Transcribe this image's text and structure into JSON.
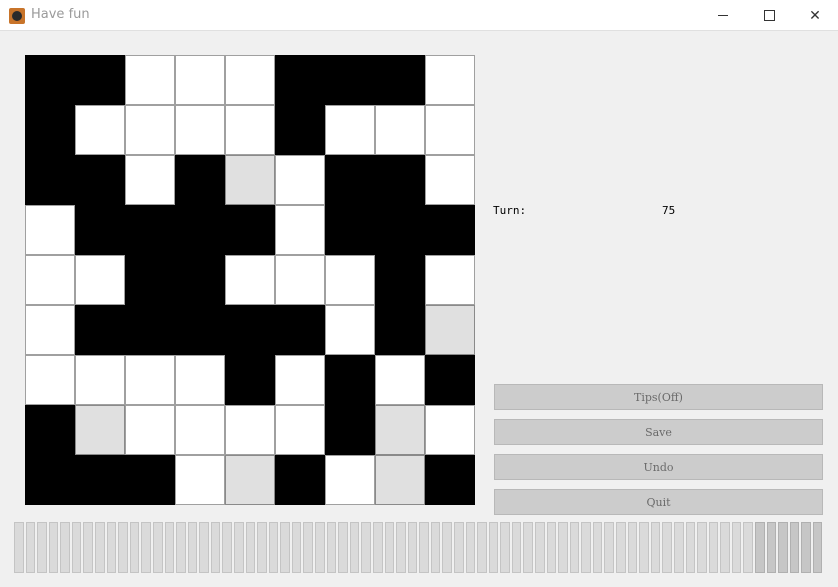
{
  "window": {
    "title": "Have fun",
    "icon": "app-icon"
  },
  "board": {
    "rows": [
      [
        "b",
        "b",
        "w",
        "w",
        "w",
        "b",
        "b",
        "b",
        "w"
      ],
      [
        "b",
        "w",
        "w",
        "w",
        "w",
        "b",
        "w",
        "w",
        "w"
      ],
      [
        "b",
        "b",
        "w",
        "b",
        "g",
        "w",
        "b",
        "b",
        "w"
      ],
      [
        "w",
        "b",
        "b",
        "b",
        "b",
        "w",
        "b",
        "b",
        "b"
      ],
      [
        "w",
        "w",
        "b",
        "b",
        "w",
        "w",
        "w",
        "b",
        "w"
      ],
      [
        "w",
        "b",
        "b",
        "b",
        "b",
        "b",
        "w",
        "b",
        "g"
      ],
      [
        "w",
        "w",
        "w",
        "w",
        "b",
        "w",
        "b",
        "w",
        "b"
      ],
      [
        "b",
        "g",
        "w",
        "w",
        "w",
        "w",
        "b",
        "g",
        "w"
      ],
      [
        "b",
        "b",
        "b",
        "w",
        "g",
        "b",
        "w",
        "g",
        "b"
      ]
    ]
  },
  "status": {
    "turn_label": "Turn:",
    "turn_value": "75"
  },
  "buttons": {
    "tips": "Tips(Off)",
    "save": "Save",
    "undo": "Undo",
    "quit": "Quit"
  },
  "progress": {
    "segments": 70,
    "filled_fraction": 0.92
  }
}
